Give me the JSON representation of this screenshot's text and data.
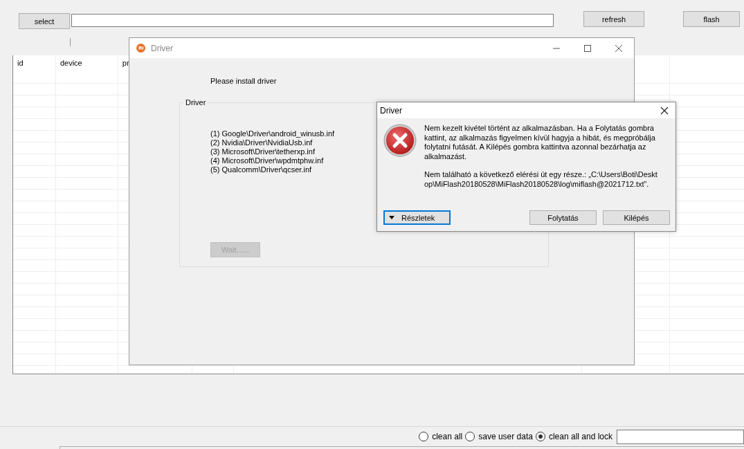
{
  "toolbar": {
    "select_button": "select",
    "refresh_button": "refresh",
    "flash_button": "flash"
  },
  "table": {
    "columns": [
      "id",
      "device",
      "pr"
    ]
  },
  "driver_window": {
    "title": "Driver",
    "message": "Please install driver",
    "group": {
      "title": "Driver",
      "items": [
        "(1) Google\\Driver\\android_winusb.inf",
        "(2) Nvidia\\Driver\\NvidiaUsb.inf",
        "(3) Microsoft\\Driver\\tetherxp.inf",
        "(4) Microsoft\\Driver\\wpdmtphw.inf",
        "(5) Qualcomm\\Driver\\qcser.inf"
      ]
    },
    "wait_button": {
      "label": "Wait......",
      "disabled": true
    }
  },
  "error_dialog": {
    "title": "Driver",
    "message": "Nem kezelt kivétel történt az alkalmazásban. Ha a Folytatás gombra kattint, az alkalmazás figyelmen kívül hagyja a hibát, és megpróbálja folytatni futását. A Kilépés gombra kattintva azonnal bezárhatja az alkalmazást.",
    "detail": "Nem található a következő elérési út egy része.: „C:\\Users\\Boti\\Desktop\\MiFlash20180528\\MiFlash20180528\\log\\miflash@2021712.txt”.",
    "details_button": "Részletek",
    "buttons": [
      "Folytatás",
      "Kilépés"
    ]
  },
  "options": [
    {
      "label": "clean all",
      "selected": false
    },
    {
      "label": "save user data",
      "selected": false
    },
    {
      "label": "clean all and lock",
      "selected": true
    }
  ]
}
